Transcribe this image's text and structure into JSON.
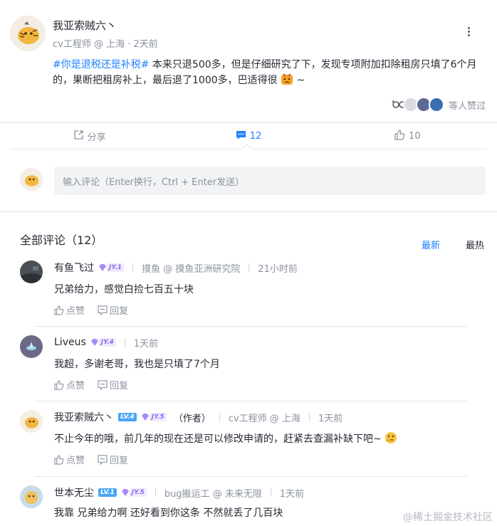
{
  "post": {
    "author": "我亚索贼六丶",
    "meta": "cv工程师 @ 上海 · 2天前",
    "topic": "#你是退税还是补税#",
    "content": " 本来只退500多，但是仔细研究了下，发现专项附加扣除租房只填了6个月的，果断把租房补上，最后退了1000多，巴适得很",
    "content_tail": " ~",
    "likers_text": "等人赞过"
  },
  "actions": {
    "share": "分享",
    "comments": "12",
    "likes": "10"
  },
  "comment_input": {
    "placeholder": "输入评论（Enter换行，Ctrl + Enter发送）"
  },
  "comments_section": {
    "title": "全部评论（12）",
    "sort_newest": "最新",
    "sort_hottest": "最热"
  },
  "comments": [
    {
      "name": "有鱼飞过",
      "badges": [
        {
          "type": "jy",
          "text": "JY.1"
        }
      ],
      "meta": "摸鱼 @ 摸鱼亚洲研究院",
      "time": "21小时前",
      "text": "兄弟给力，感觉白捡七百五十块",
      "like": "点赞",
      "reply": "回复"
    },
    {
      "name": "Liveus",
      "badges": [
        {
          "type": "jy",
          "text": "JY.4"
        }
      ],
      "time": "1天前",
      "text": "我超，多谢老哥，我也是只填了7个月",
      "like": "点赞",
      "reply": "回复"
    },
    {
      "name": "我亚索贼六丶",
      "badges": [
        {
          "type": "lv",
          "text": "LV.4"
        },
        {
          "type": "jy",
          "text": "JY.5"
        }
      ],
      "author_tag": "（作者）",
      "meta": "cv工程师 @ 上海",
      "time": "1天前",
      "text": "不止今年的哦，前几年的现在还是可以修改申请的，赶紧去查漏补缺下吧~",
      "like": "点赞",
      "reply": "回复"
    },
    {
      "name": "世本无尘",
      "badges": [
        {
          "type": "lv",
          "text": "LV.1"
        },
        {
          "type": "jy",
          "text": "JY.5"
        }
      ],
      "meta": "bug搬运工 @ 未来无限",
      "time": "1天前",
      "text": "我靠 兄弟给力啊 还好看到你这条 不然就丢了几百块"
    }
  ],
  "watermark": "@稀土掘金技术社区",
  "colors": {
    "accent": "#1e80ff",
    "text": "#252933",
    "muted": "#8a919f",
    "jy_badge": "#8b6cf0",
    "lv_badge": "#4aa5f5"
  }
}
